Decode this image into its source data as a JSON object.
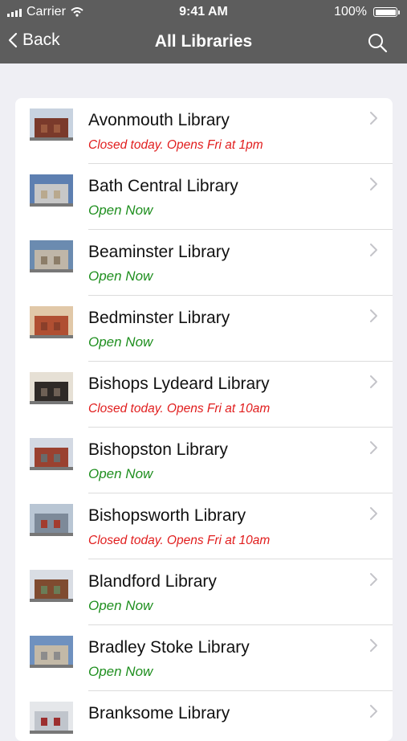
{
  "status_bar": {
    "carrier": "Carrier",
    "time": "9:41 AM",
    "battery": "100%"
  },
  "nav": {
    "back_label": "Back",
    "title": "All Libraries"
  },
  "libraries": [
    {
      "name": "Avonmouth Library",
      "status": "Closed today. Opens Fri at 1pm",
      "open": false
    },
    {
      "name": "Bath Central Library",
      "status": "Open Now",
      "open": true
    },
    {
      "name": "Beaminster Library",
      "status": "Open Now",
      "open": true
    },
    {
      "name": "Bedminster Library",
      "status": "Open Now",
      "open": true
    },
    {
      "name": "Bishops Lydeard Library",
      "status": "Closed today. Opens Fri at 10am",
      "open": false
    },
    {
      "name": "Bishopston Library",
      "status": "Open Now",
      "open": true
    },
    {
      "name": "Bishopsworth Library",
      "status": "Closed today. Opens Fri at 10am",
      "open": false
    },
    {
      "name": "Blandford Library",
      "status": "Open Now",
      "open": true
    },
    {
      "name": "Bradley Stoke Library",
      "status": "Open Now",
      "open": true
    },
    {
      "name": "Branksome Library",
      "status": "",
      "open": true
    }
  ],
  "colors": {
    "nav_bg": "#5d5d5d",
    "open": "#1f8f1f",
    "closed": "#e11d1d"
  }
}
